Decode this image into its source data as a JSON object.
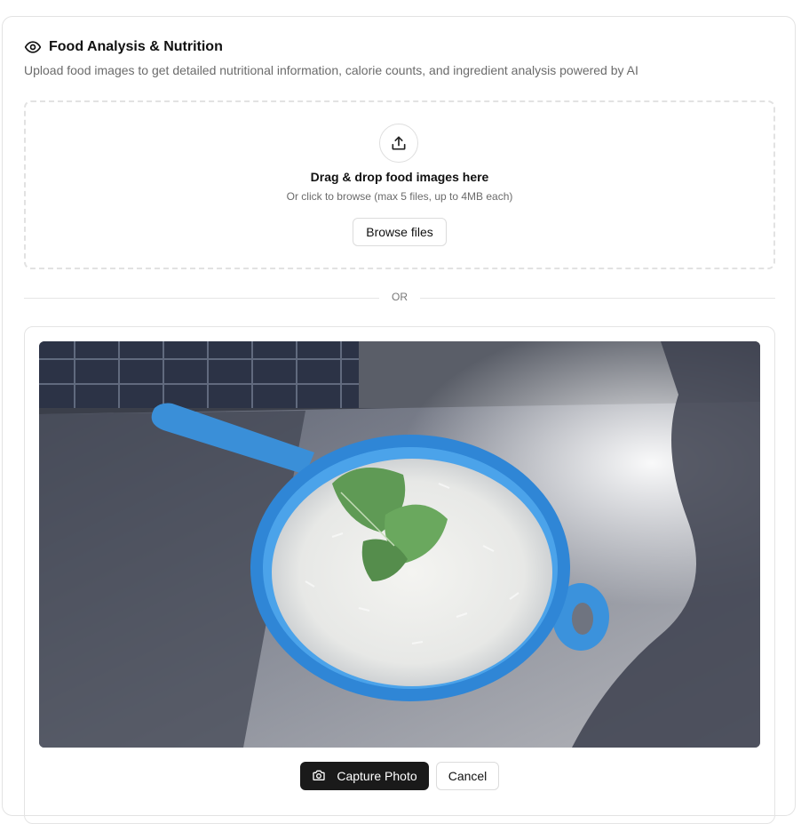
{
  "header": {
    "icon": "eye-icon",
    "title": "Food Analysis & Nutrition",
    "subtitle": "Upload food images to get detailed nutritional information, calorie counts, and ingredient analysis powered by AI"
  },
  "dropzone": {
    "icon": "upload-icon",
    "title": "Drag & drop food images here",
    "hint": "Or click to browse (max 5 files, up to 4MB each)",
    "browse_label": "Browse files"
  },
  "divider": {
    "label": "OR"
  },
  "camera": {
    "preview_subject": "bowl of white rice with mint leaves",
    "capture_icon": "camera-icon",
    "capture_label": "Capture Photo",
    "cancel_label": "Cancel"
  },
  "colors": {
    "primary_button": "#1a1a1a",
    "border": "#e3e3e3",
    "muted_text": "#6b6b6b"
  }
}
